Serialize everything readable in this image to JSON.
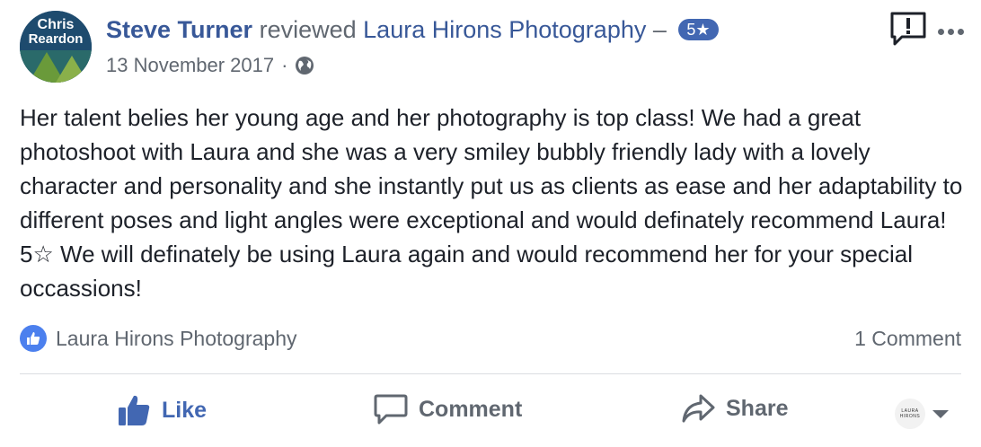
{
  "post": {
    "author": "Steve Turner",
    "verb": "reviewed",
    "page_name": "Laura Hirons Photography",
    "dash": "–",
    "rating_badge": "5★",
    "date": "13 November 2017",
    "separator": "·",
    "audience_icon": "globe-icon",
    "avatar_text_top": "Chris",
    "avatar_text_bottom": "Reardon",
    "review_text": "Her talent belies her young age and her photography is top class! We had a great photoshoot with Laura and she was a very smiley bubbly friendly lady with a lovely character and personality and she instantly put us as clients as ease and her adaptability to different poses and light angles were exceptional and would definately recommend Laura! 5☆ We will definately be using Laura again and would recommend her for your special occassions!"
  },
  "reactions": {
    "icon": "like-icon",
    "liked_by": "Laura Hirons Photography",
    "comment_count": "1 Comment"
  },
  "actions": {
    "like": "Like",
    "comment": "Comment",
    "share": "Share"
  },
  "identity": {
    "avatar_label": "LAURA HIRONS"
  },
  "colors": {
    "link": "#385898",
    "accent": "#4267b2",
    "muted": "#606770"
  }
}
